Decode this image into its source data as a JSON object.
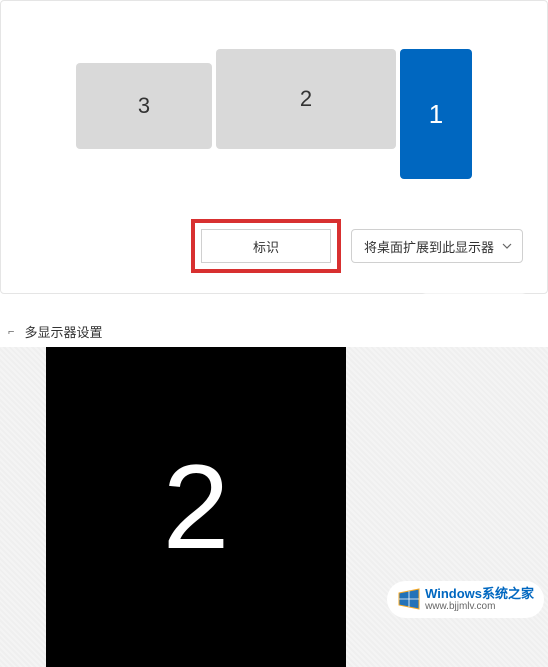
{
  "displays": {
    "monitor1": "1",
    "monitor2": "2",
    "monitor3": "3"
  },
  "controls": {
    "identify_label": "标识",
    "extend_label": "将桌面扩展到此显示器"
  },
  "section": {
    "multi_display_label": "多显示器设置"
  },
  "overlay": {
    "identify_number": "2"
  },
  "watermark": {
    "title": "Windows系统之家",
    "url": "www.bjjmlv.com"
  }
}
